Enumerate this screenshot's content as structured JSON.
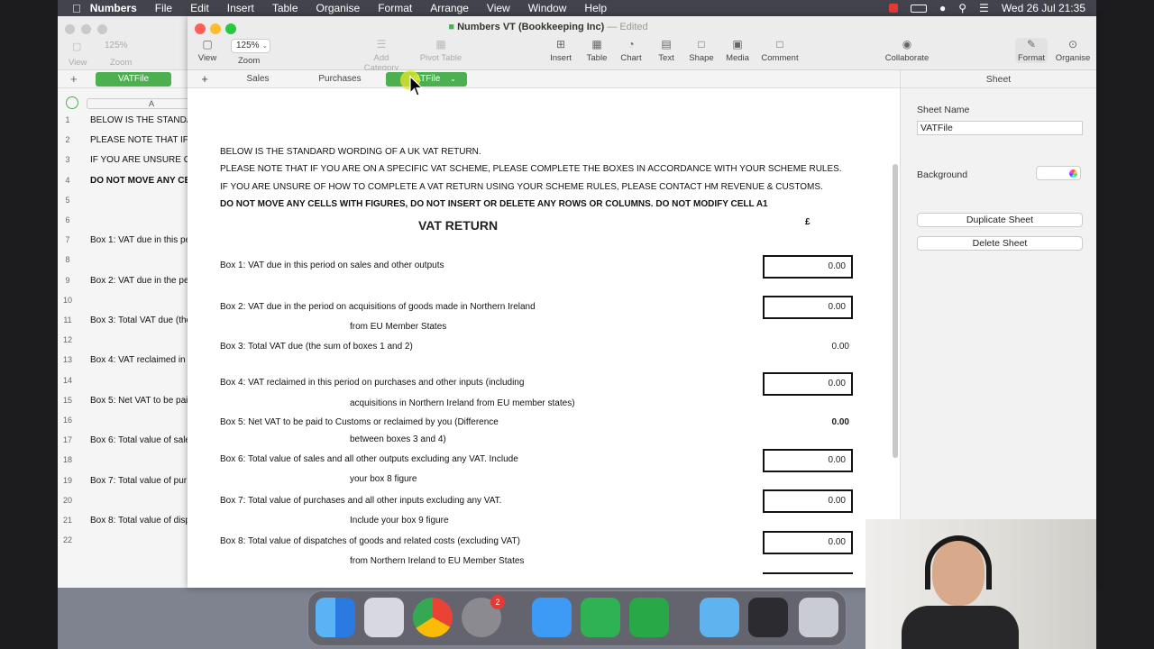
{
  "menubar": {
    "app": "Numbers",
    "items": [
      "File",
      "Edit",
      "Insert",
      "Table",
      "Organise",
      "Format",
      "Arrange",
      "View",
      "Window",
      "Help"
    ],
    "clock": "Wed 26 Jul  21:35"
  },
  "back_window": {
    "zoom": "125%",
    "view_label": "View",
    "zoom_label": "Zoom",
    "sheet_tab": "VATFile",
    "column_a": "A",
    "rows": [
      {
        "n": "1",
        "text": "BELOW IS THE STANDA"
      },
      {
        "n": "2",
        "text": "PLEASE NOTE THAT IF"
      },
      {
        "n": "3",
        "text": "IF YOU ARE UNSURE O"
      },
      {
        "n": "4",
        "text": "DO NOT MOVE ANY CE"
      },
      {
        "n": "5",
        "text": ""
      },
      {
        "n": "6",
        "text": ""
      },
      {
        "n": "7",
        "text": "Box 1: VAT due in this pe"
      },
      {
        "n": "8",
        "text": ""
      },
      {
        "n": "9",
        "text": "Box 2: VAT due in the pe"
      },
      {
        "n": "10",
        "text": ""
      },
      {
        "n": "11",
        "text": "Box 3: Total VAT due (the"
      },
      {
        "n": "12",
        "text": ""
      },
      {
        "n": "13",
        "text": "Box 4: VAT reclaimed in"
      },
      {
        "n": "14",
        "text": ""
      },
      {
        "n": "15",
        "text": "Box 5: Net VAT to be pai"
      },
      {
        "n": "16",
        "text": ""
      },
      {
        "n": "17",
        "text": "Box 6: Total value of sale"
      },
      {
        "n": "18",
        "text": ""
      },
      {
        "n": "19",
        "text": "Box 7: Total value of pur"
      },
      {
        "n": "20",
        "text": ""
      },
      {
        "n": "21",
        "text": "Box 8: Total value of disp"
      },
      {
        "n": "22",
        "text": ""
      }
    ]
  },
  "window": {
    "title": "Numbers VT (Bookkeeping Inc)",
    "edited": "— Edited",
    "zoom": "125%",
    "toolbar": {
      "view": "View",
      "zoom": "Zoom",
      "add_category": "Add Category",
      "pivot_table": "Pivot Table",
      "insert": "Insert",
      "table": "Table",
      "chart": "Chart",
      "text": "Text",
      "shape": "Shape",
      "media": "Media",
      "comment": "Comment",
      "collaborate": "Collaborate",
      "format": "Format",
      "organise": "Organise"
    },
    "sheets": [
      "Sales",
      "Purchases",
      "VATFile"
    ],
    "active_sheet": "VATFile"
  },
  "sheet": {
    "lines": [
      "BELOW IS THE STANDARD WORDING OF A UK VAT RETURN.",
      "PLEASE NOTE THAT IF YOU ARE ON A SPECIFIC VAT SCHEME, PLEASE COMPLETE THE BOXES IN ACCORDANCE WITH YOUR SCHEME RULES.",
      "IF YOU ARE UNSURE OF HOW TO COMPLETE A VAT RETURN USING YOUR SCHEME RULES, PLEASE CONTACT HM REVENUE & CUSTOMS.",
      "DO NOT MOVE ANY CELLS WITH FIGURES, DO NOT INSERT OR DELETE ANY ROWS OR COLUMNS. DO NOT MODIFY CELL A1"
    ],
    "heading": "VAT RETURN",
    "currency": "£",
    "boxes": [
      {
        "label": "Box 1: VAT due in this period on sales and other outputs",
        "sub": "",
        "value": "0.00"
      },
      {
        "label": "Box 2: VAT due in the period on acquisitions of goods made in Northern Ireland",
        "sub": "from EU Member States",
        "value": "0.00"
      },
      {
        "label": "Box 3: Total VAT due (the sum of boxes 1 and 2)",
        "sub": "",
        "value": "0.00"
      },
      {
        "label": "Box 4: VAT reclaimed in this period on purchases and other inputs (including",
        "sub": "acquisitions in Northern Ireland from EU member states)",
        "value": "0.00"
      },
      {
        "label": "Box 5: Net VAT to be paid to Customs or reclaimed by you (Difference",
        "sub": "between boxes 3 and 4)",
        "value": "0.00"
      },
      {
        "label": "Box 6: Total value of sales and all other outputs excluding any VAT. Include",
        "sub": "your box 8 figure",
        "value": "0.00"
      },
      {
        "label": "Box 7: Total value of purchases and all other inputs excluding any VAT.",
        "sub": "Include your box 9 figure",
        "value": "0.00"
      },
      {
        "label": "Box 8: Total value of dispatches of goods and related costs (excluding VAT)",
        "sub": "from Northern Ireland to EU Member States",
        "value": "0.00"
      }
    ]
  },
  "inspector": {
    "header": "Sheet",
    "sheet_name_label": "Sheet Name",
    "sheet_name_value": "VATFile",
    "background_label": "Background",
    "duplicate": "Duplicate Sheet",
    "delete": "Delete Sheet"
  },
  "dock": {
    "settings_badge": "2"
  },
  "colors": {
    "accent_green": "#4caf50",
    "menubar": "#43434d"
  }
}
